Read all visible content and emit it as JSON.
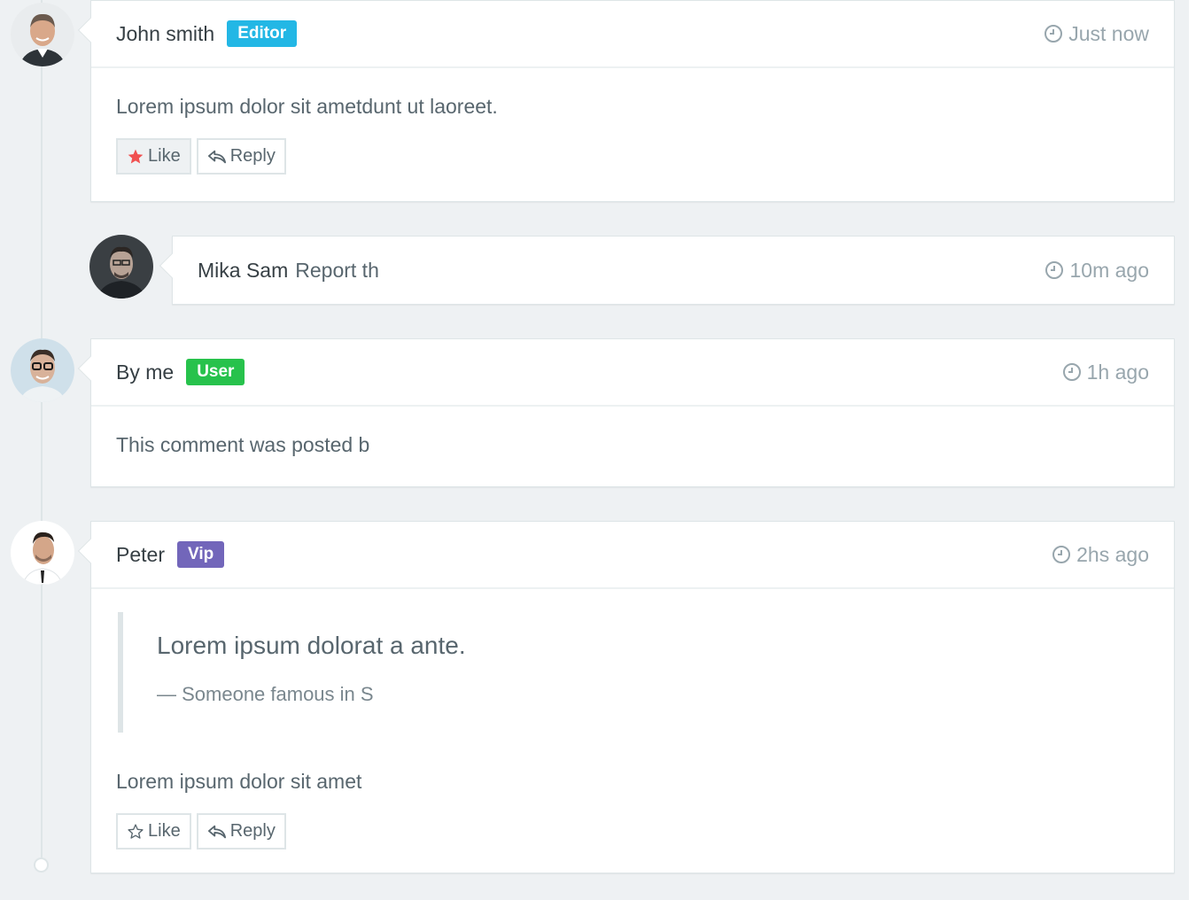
{
  "comments": [
    {
      "author": "John smith",
      "badge": "Editor",
      "badge_color": "#23b7e5",
      "time": "Just now",
      "text": "Lorem ipsum dolor sit ametdunt ut laoreet.",
      "like_label": "Like",
      "reply_label": "Reply",
      "liked": true
    },
    {
      "author": "Mika Sam",
      "inline_text": "Report th",
      "time": "10m ago"
    },
    {
      "author": "By me",
      "badge": "User",
      "badge_color": "#27c24c",
      "time": "1h ago",
      "text": "This comment was posted b"
    },
    {
      "author": "Peter",
      "badge": "Vip",
      "badge_color": "#7266ba",
      "time": "2hs ago",
      "quote": "Lorem ipsum dolorat a ante.",
      "quote_cite": "— Someone famous in S",
      "text": "Lorem ipsum dolor sit amet",
      "like_label": "Like",
      "reply_label": "Reply",
      "liked": false
    }
  ]
}
